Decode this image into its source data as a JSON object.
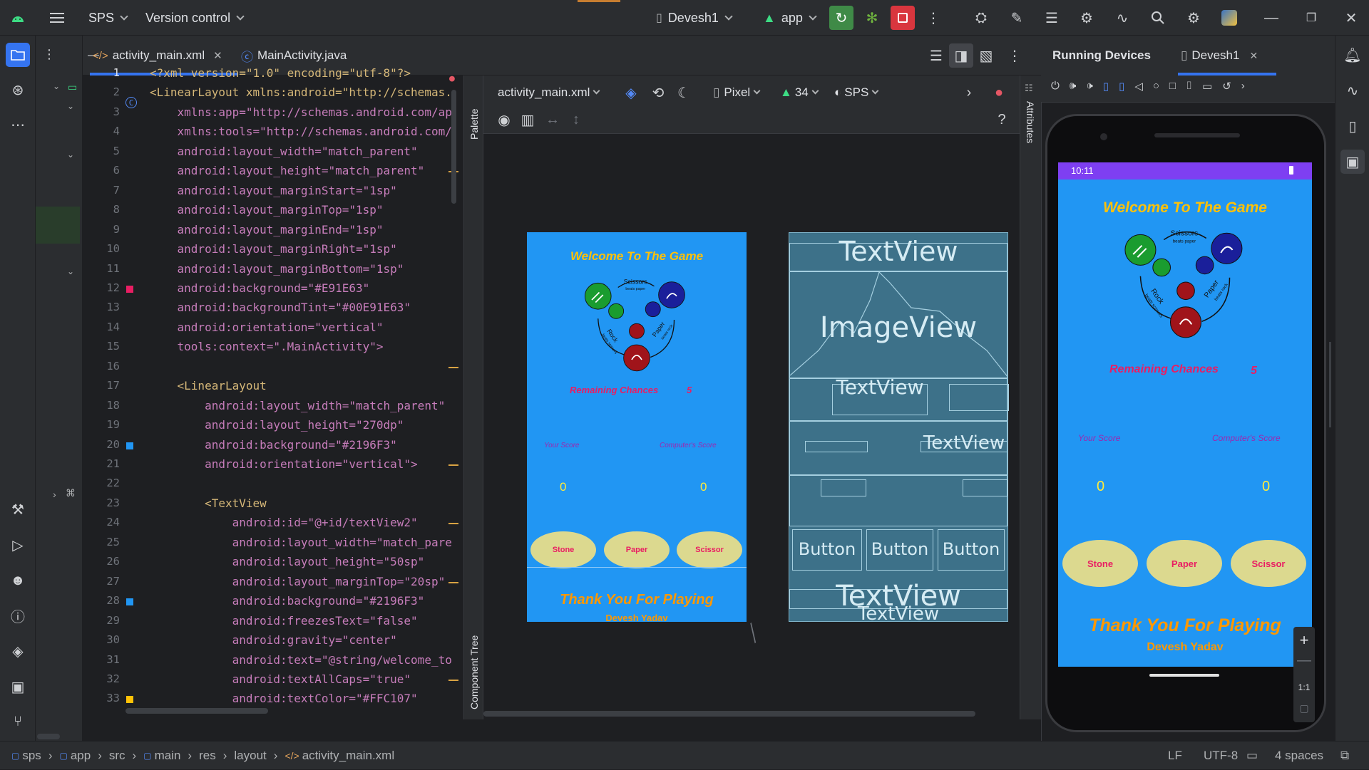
{
  "titlebar": {
    "project": "SPS",
    "vcs": "Version control",
    "device": "Devesh1",
    "run_config": "app"
  },
  "editor_tabs": [
    {
      "label": "activity_main.xml",
      "active": true
    },
    {
      "label": "MainActivity.java",
      "active": false
    }
  ],
  "line_numbers": [
    "1",
    "2",
    "3",
    "4",
    "5",
    "6",
    "7",
    "8",
    "9",
    "10",
    "11",
    "12",
    "13",
    "14",
    "15",
    "16",
    "17",
    "18",
    "19",
    "20",
    "21",
    "22",
    "23",
    "24",
    "25",
    "26",
    "27",
    "28",
    "29",
    "30",
    "31",
    "32",
    "33"
  ],
  "code_lines": [
    "<?xml version=\"1.0\" encoding=\"utf-8\"?>",
    "<LinearLayout xmlns:android=\"http://schemas.",
    "    xmlns:app=\"http://schemas.android.com/ap",
    "    xmlns:tools=\"http://schemas.android.com/",
    "    android:layout_width=\"match_parent\"",
    "    android:layout_height=\"match_parent\"",
    "    android:layout_marginStart=\"1sp\"",
    "    android:layout_marginTop=\"1sp\"",
    "    android:layout_marginEnd=\"1sp\"",
    "    android:layout_marginRight=\"1sp\"",
    "    android:layout_marginBottom=\"1sp\"",
    "    android:background=\"#E91E63\"",
    "    android:backgroundTint=\"#00E91E63\"",
    "    android:orientation=\"vertical\"",
    "    tools:context=\".MainActivity\">",
    "",
    "    <LinearLayout",
    "        android:layout_width=\"match_parent\"",
    "        android:layout_height=\"270dp\"",
    "        android:background=\"#2196F3\"",
    "        android:orientation=\"vertical\">",
    "",
    "        <TextView",
    "            android:id=\"@+id/textView2\"",
    "            android:layout_width=\"match_pare",
    "            android:layout_height=\"50sp\"",
    "            android:layout_marginTop=\"20sp\"",
    "            android:background=\"#2196F3\"",
    "            android:freezesText=\"false\"",
    "            android:gravity=\"center\"",
    "            android:text=\"@string/welcome_to",
    "            android:textAllCaps=\"true\"",
    "            android:textColor=\"#FFC107\""
  ],
  "gutter_swatches": [
    {
      "line": 12,
      "color": "#E91E63"
    },
    {
      "line": 20,
      "color": "#2196F3"
    },
    {
      "line": 28,
      "color": "#2196F3"
    },
    {
      "line": 33,
      "color": "#FFC107"
    }
  ],
  "side_panels": {
    "palette": "Palette",
    "component_tree": "Component Tree",
    "attributes": "Attributes"
  },
  "designer_toolbar": {
    "file": "activity_main.xml",
    "device": "Pixel",
    "api": "34",
    "theme": "SPS"
  },
  "app_screen": {
    "title": "Welcome To The Game",
    "remaining_label": "Remaining Chances",
    "remaining_value": "5",
    "your_score_label": "Your Score",
    "computer_score_label": "Computer's Score",
    "your_score": "0",
    "computer_score": "0",
    "buttons": [
      "Stone",
      "Paper",
      "Scissor"
    ],
    "thank_you": "Thank You For Playing",
    "author": "Devesh Yadav",
    "cycle_labels": {
      "scissors": "Scissors",
      "scissors_sub": "beats paper",
      "rock": "Rock",
      "rock_sub": "beats scissors",
      "paper": "Paper",
      "paper_sub": "beats rock"
    }
  },
  "blueprint": {
    "textview": "TextView",
    "imageview": "ImageView",
    "button": "Button"
  },
  "running_devices": {
    "title": "Running Devices",
    "device_tab": "Devesh1",
    "clock": "10:11",
    "zoom_reset": "1:1"
  },
  "statusbar": {
    "breadcrumbs": [
      "sps",
      "app",
      "src",
      "main",
      "res",
      "layout",
      "activity_main.xml"
    ],
    "line_sep": "LF",
    "encoding": "UTF-8",
    "indent": "4 spaces"
  },
  "colors": {
    "app_blue": "#2196F3",
    "welcome_yellow": "#FFC107",
    "pink": "#E91E63",
    "orange": "#FF9800",
    "button_cream": "#DCD98F",
    "run_green": "#4CAF50",
    "stop_red": "#D9363E"
  }
}
